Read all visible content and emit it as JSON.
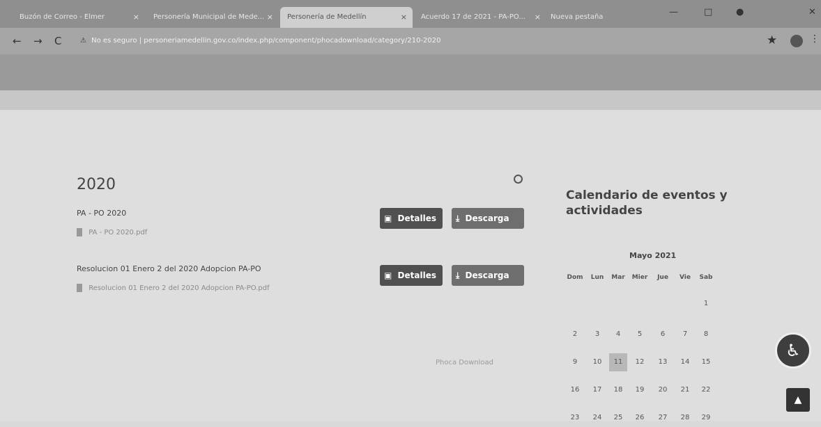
{
  "browser": {
    "tabs": [
      {
        "label": "Buzón de Correo - Elmer"
      },
      {
        "label": "Personería Municipal de Mede..."
      },
      {
        "label": "Personería de Medellín"
      },
      {
        "label": "Acuerdo 17 de 2021 - PA-PO..."
      }
    ],
    "new_tab_label": "Nueva pestaña",
    "security_label": "No es seguro",
    "url": "personeriamedellin.gov.co/index.php/component/phocadownload/category/210-2020"
  },
  "page": {
    "title": "2020",
    "documents": [
      {
        "title": "PA - PO 2020",
        "file": "PA - PO 2020.pdf",
        "details_label": "Detalles",
        "download_label": "Descarga"
      },
      {
        "title": "Resolucion 01 Enero 2 del 2020 Adopcion PA-PO",
        "file": "Resolucion 01 Enero 2 del 2020 Adopcion PA-PO.pdf",
        "details_label": "Detalles",
        "download_label": "Descarga"
      }
    ],
    "footer_credit": "Phoca Download"
  },
  "calendar": {
    "title": "Calendario de eventos y actividades",
    "month": "Mayo 2021",
    "weekdays": [
      "Dom",
      "Lun",
      "Mar",
      "Mier",
      "Jue",
      "Vie",
      "Sab"
    ],
    "weeks": [
      [
        "",
        "",
        "",
        "",
        "",
        "",
        "1"
      ],
      [
        "2",
        "3",
        "4",
        "5",
        "6",
        "7",
        "8"
      ],
      [
        "9",
        "10",
        "11",
        "12",
        "13",
        "14",
        "15"
      ],
      [
        "16",
        "17",
        "18",
        "19",
        "20",
        "21",
        "22"
      ],
      [
        "23",
        "24",
        "25",
        "26",
        "27",
        "28",
        "29"
      ]
    ],
    "today": "11"
  },
  "widgets": {
    "accessibility_icon": "wheelchair-icon",
    "scroll_top_icon": "chevron-up-icon"
  }
}
